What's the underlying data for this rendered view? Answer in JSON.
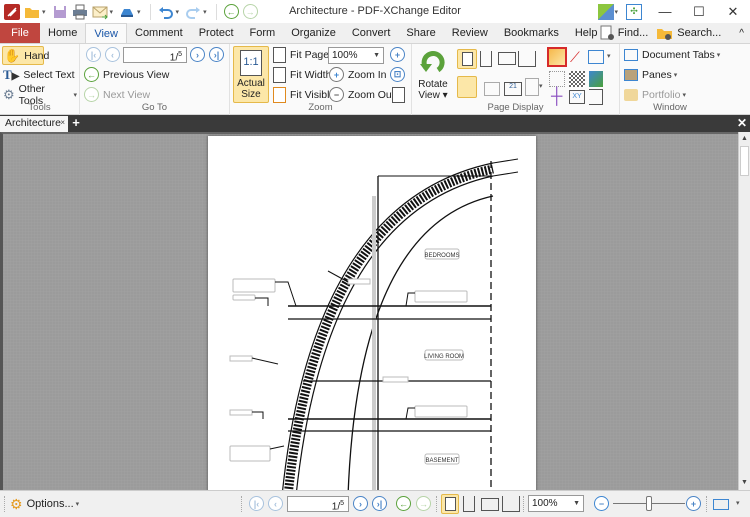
{
  "window": {
    "title": "Architecture - PDF-XChange Editor",
    "controls": {
      "minimize": "—",
      "maximize": "☐",
      "close": "✕"
    }
  },
  "quick_access": {
    "icons": [
      "app-logo-icon",
      "open-folder-icon",
      "save-icon",
      "print-icon",
      "email-icon",
      "scan-icon",
      "undo-icon",
      "redo-icon",
      "back-icon",
      "forward-icon"
    ]
  },
  "menu": {
    "tabs": [
      "File",
      "Home",
      "View",
      "Comment",
      "Protect",
      "Form",
      "Organize",
      "Convert",
      "Share",
      "Review",
      "Bookmarks",
      "Help"
    ],
    "active": "View",
    "find_label": "Find...",
    "search_label": "Search...",
    "collapse_glyph": "^"
  },
  "ribbon": {
    "tools": {
      "label": "Tools",
      "hand": "Hand",
      "select_text": "Select Text",
      "other_tools": "Other Tools"
    },
    "goto": {
      "label": "Go To",
      "page_value": "1",
      "page_total": "5",
      "previous_view": "Previous View",
      "next_view": "Next View"
    },
    "zoom": {
      "label": "Zoom",
      "actual_size_line1": "Actual",
      "actual_size_line2": "Size",
      "actual_size_icon": "1:1",
      "fit_page": "Fit Page",
      "fit_width": "Fit Width",
      "fit_visible": "Fit Visible",
      "zoom_value": "100%",
      "zoom_in": "Zoom In",
      "zoom_out": "Zoom Out"
    },
    "page_display": {
      "label": "Page Display",
      "rotate_line1": "Rotate",
      "rotate_line2": "View"
    },
    "window": {
      "label": "Window",
      "document_tabs": "Document Tabs",
      "panes": "Panes",
      "portfolio": "Portfolio"
    }
  },
  "document_tabs": {
    "tabs": [
      {
        "label": "Architecture",
        "active": true
      }
    ],
    "add_glyph": "+",
    "close_glyph": "×"
  },
  "drawing": {
    "rooms": [
      "BEDROOMS",
      "LIVING ROOM",
      "BASEMENT"
    ]
  },
  "statusbar": {
    "options_label": "Options...",
    "page_value": "1",
    "page_total": "5",
    "zoom_value": "100%",
    "zoom_slider_fraction": 0.5
  },
  "colors": {
    "file_tab": "#c0463f",
    "accent_blue": "#1a56a8",
    "highlight": "#fce7a8",
    "doc_bar": "#3a3a3a",
    "viewer_bg": "#9b9b9b"
  }
}
